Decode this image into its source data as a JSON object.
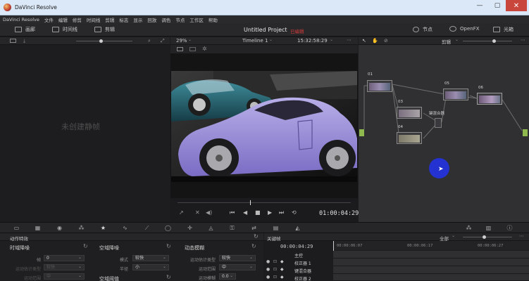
{
  "window": {
    "title": "DaVinci Resolve"
  },
  "menu": [
    "DaVinci Resolve",
    "文件",
    "编辑",
    "修剪",
    "时间线",
    "剪辑",
    "标志",
    "显示",
    "回放",
    "调色",
    "节点",
    "工作区",
    "帮助"
  ],
  "toolbar": {
    "gallery_label": "画廊",
    "timeline_label": "时间线",
    "clips_label": "剪辑",
    "project_title": "Untitled Project",
    "project_status": "已编辑",
    "nodes_label": "节点",
    "openfx_label": "OpenFX",
    "lightbox_label": "光箱"
  },
  "gallery": {
    "empty_text": "未创建静帧"
  },
  "viewer": {
    "zoom": "29%",
    "timeline_name": "Timeline 1",
    "source_timecode": "15:32:58:29",
    "timecode": "01:00:04:29"
  },
  "node_editor": {
    "mode": "剪辑",
    "nodes": [
      {
        "num": "01",
        "label": "01"
      },
      {
        "num": "03",
        "label": "03"
      },
      {
        "num": "04",
        "label": "04"
      },
      {
        "num": "05",
        "label": "05"
      },
      {
        "num": "06",
        "label": "06"
      }
    ],
    "mixer_label": "键混合器"
  },
  "fx_panel": {
    "title": "动作特效",
    "sections": {
      "temporal_nr": {
        "title": "时域降噪",
        "frames_label": "帧",
        "frames_value": "0",
        "motion_est_label": "运动估计类型",
        "motion_est_value": "较快",
        "motion_range_label": "运动范围",
        "motion_range_value": "中"
      },
      "spatial_nr": {
        "title": "空域降噪",
        "mode_label": "模式",
        "mode_value": "较快",
        "radius_label": "半径",
        "radius_value": "小",
        "threshold_title": "空域阈值"
      },
      "motion_blur": {
        "title": "动态模糊",
        "motion_est_label": "运动估计类型",
        "motion_est_value": "较快",
        "motion_range_label": "运动范围",
        "motion_range_value": "中",
        "blur_label": "运动模糊",
        "blur_value": "0.0"
      }
    }
  },
  "keyframes": {
    "title": "关键帧",
    "filter": "全部",
    "current_tc": "00:00:04:29",
    "ruler": [
      "00:00:06:07",
      "00:00:06:17",
      "00:00:06:27"
    ],
    "rows": [
      "主控",
      "校正器 1",
      "键混合器",
      "校正器 2"
    ]
  },
  "colors": {
    "accent": "#2332d0",
    "status_red": "#d43b3b",
    "bg_dark": "#1c1c1e"
  }
}
